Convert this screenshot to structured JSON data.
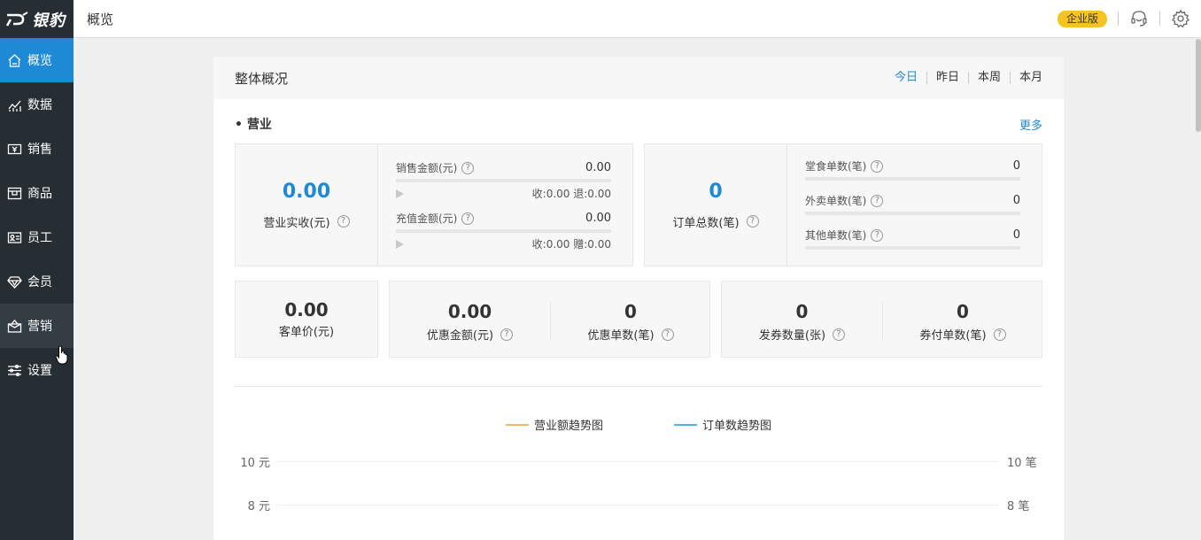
{
  "app": {
    "logo_text": "银豹"
  },
  "sidebar": {
    "items": [
      {
        "label": "概览",
        "icon": "home-icon"
      },
      {
        "label": "数据",
        "icon": "chart-icon"
      },
      {
        "label": "销售",
        "icon": "cash-icon"
      },
      {
        "label": "商品",
        "icon": "box-icon"
      },
      {
        "label": "员工",
        "icon": "id-card-icon"
      },
      {
        "label": "会员",
        "icon": "diamond-icon"
      },
      {
        "label": "营销",
        "icon": "gift-icon"
      },
      {
        "label": "设置",
        "icon": "sliders-icon"
      }
    ],
    "active_index": 0,
    "hover_index": 6
  },
  "header": {
    "title": "概览",
    "badge": "企业版",
    "icons": [
      "support-headset-icon",
      "settings-gear-icon"
    ]
  },
  "overview": {
    "title": "整体概况",
    "periods": [
      "今日",
      "昨日",
      "本周",
      "本月"
    ],
    "active_period": "今日",
    "section_title": "• 营业",
    "more": "更多",
    "revenue": {
      "value": "0.00",
      "label": "营业实收(元)",
      "sales_label": "销售金额(元)",
      "sales_value": "0.00",
      "sales_sub": "收:0.00 退:0.00",
      "recharge_label": "充值金额(元)",
      "recharge_value": "0.00",
      "recharge_sub": "收:0.00 赠:0.00"
    },
    "orders": {
      "value": "0",
      "label": "订单总数(笔)",
      "dine_in_label": "堂食单数(笔)",
      "dine_in_value": "0",
      "takeout_label": "外卖单数(笔)",
      "takeout_value": "0",
      "other_label": "其他单数(笔)",
      "other_value": "0"
    },
    "avg_price": {
      "value": "0.00",
      "label": "客单价(元)"
    },
    "discount_amount": {
      "value": "0.00",
      "label": "优惠金额(元)"
    },
    "discount_orders": {
      "value": "0",
      "label": "优惠单数(笔)"
    },
    "coupons_issued": {
      "value": "0",
      "label": "发券数量(张)"
    },
    "coupon_orders": {
      "value": "0",
      "label": "券付单数(笔)"
    },
    "help_glyph": "?"
  },
  "trend": {
    "legend": [
      {
        "label": "营业额趋势图",
        "color": "#f7b36b"
      },
      {
        "label": "订单数趋势图",
        "color": "#5aaee8"
      }
    ],
    "left_ticks": [
      "10 元",
      "8 元"
    ],
    "right_ticks": [
      "10 笔",
      "8 笔"
    ]
  }
}
